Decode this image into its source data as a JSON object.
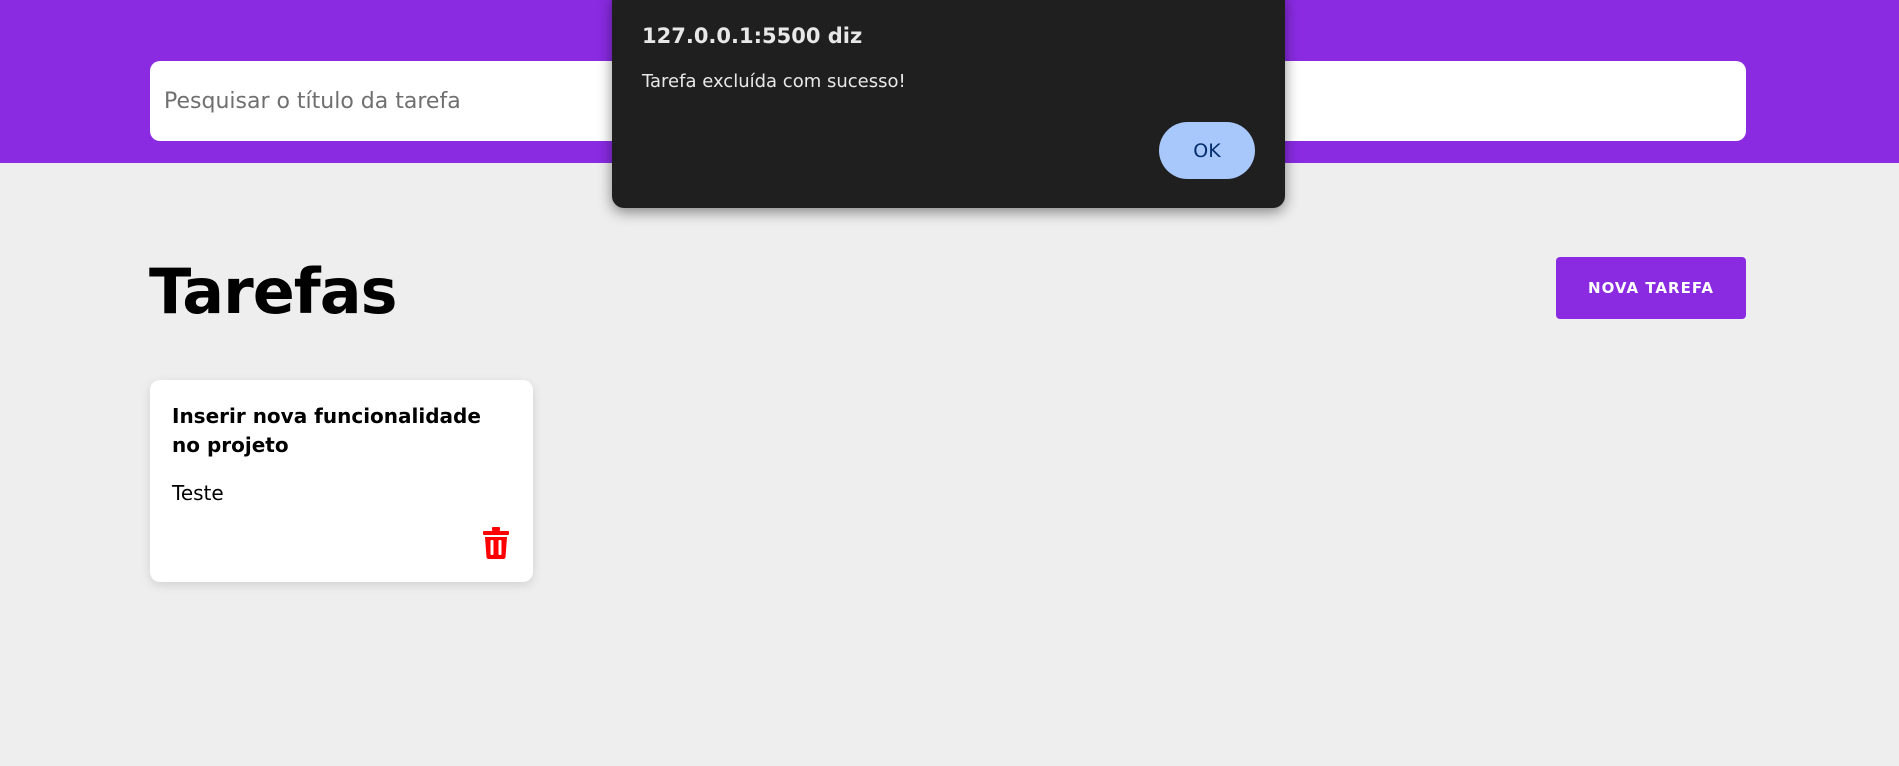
{
  "header": {
    "background_color": "#8a2be2",
    "search": {
      "placeholder": "Pesquisar o título da tarefa",
      "value": ""
    }
  },
  "main": {
    "title": "Tarefas",
    "new_task_label": "NOVA TAREFA",
    "accent_color": "#8a2be2",
    "tasks": [
      {
        "title": "Inserir nova funcionalidade no projeto",
        "description": "Teste",
        "delete_icon": "trash-icon",
        "delete_icon_color": "#ff0000"
      }
    ]
  },
  "dialog": {
    "title": "127.0.0.1:5500 diz",
    "message": "Tarefa excluída com sucesso!",
    "ok_label": "OK",
    "ok_button_color": "#a8c7fa"
  }
}
